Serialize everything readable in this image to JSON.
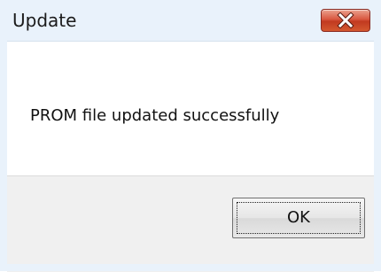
{
  "window": {
    "title": "Update",
    "close_icon": "close-icon"
  },
  "message": {
    "text": "PROM file updated successfully"
  },
  "buttons": {
    "ok_label": "OK"
  }
}
